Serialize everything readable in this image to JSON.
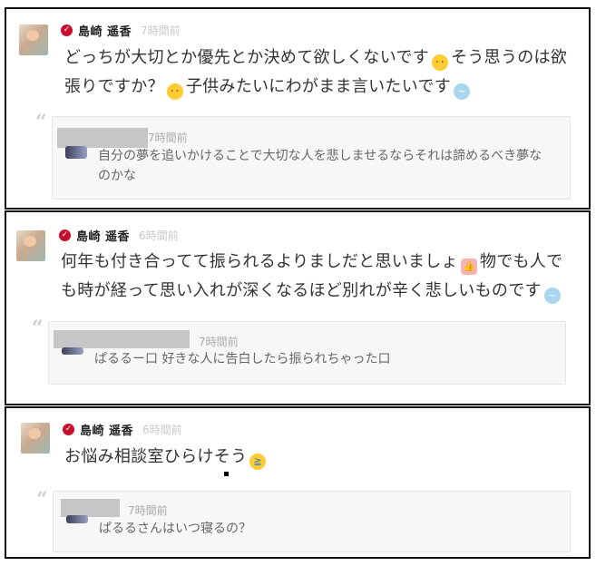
{
  "posts": [
    {
      "author": "島崎 遥香",
      "time": "7時間前",
      "message_line1": "どっちが大切とか優先とか決めて欲しくないです",
      "message_line1b": "そう思うのは欲",
      "message_line2a": "張りですか？",
      "message_line2b": "子供みたいにわがまま言いたいです",
      "quote": {
        "time": "7時間前",
        "text_line1": "自分の夢を追いかけることで大切な人を悲しませるならそれは諦めるべき夢な",
        "text_line2": "のかな"
      }
    },
    {
      "author": "島崎 遥香",
      "time": "6時間前",
      "message_line1": "何年も付き合ってて振られるよりましだと思いましょ",
      "message_line1b": "物でも人で",
      "message_line2": "も時が経って思い入れが深くなるほど別れが辛く悲しいものです",
      "quote": {
        "time": "7時間前",
        "text": "ぱるるー口 好きな人に告白したら振られちゃった口"
      }
    },
    {
      "author": "島崎 遥香",
      "time": "6時間前",
      "message": "お悩み相談室ひらけそう",
      "quote": {
        "time": "7時間前",
        "text": "ぱるるさんはいつ寝るの？"
      }
    }
  ],
  "icons": {
    "verified": "verified-badge-icon",
    "quote": "quote-icon",
    "emoji_sweat": "sweat-face-emoji",
    "emoji_pout": "pout-face-emoji",
    "emoji_cloud": "cloud-emoji",
    "emoji_thumb": "thumbs-up-emoji",
    "emoji_cry": "tears-of-joy-emoji"
  },
  "colors": {
    "verified": "#c8102e",
    "border": "#111111",
    "quote_bg": "#f7f7f7"
  }
}
